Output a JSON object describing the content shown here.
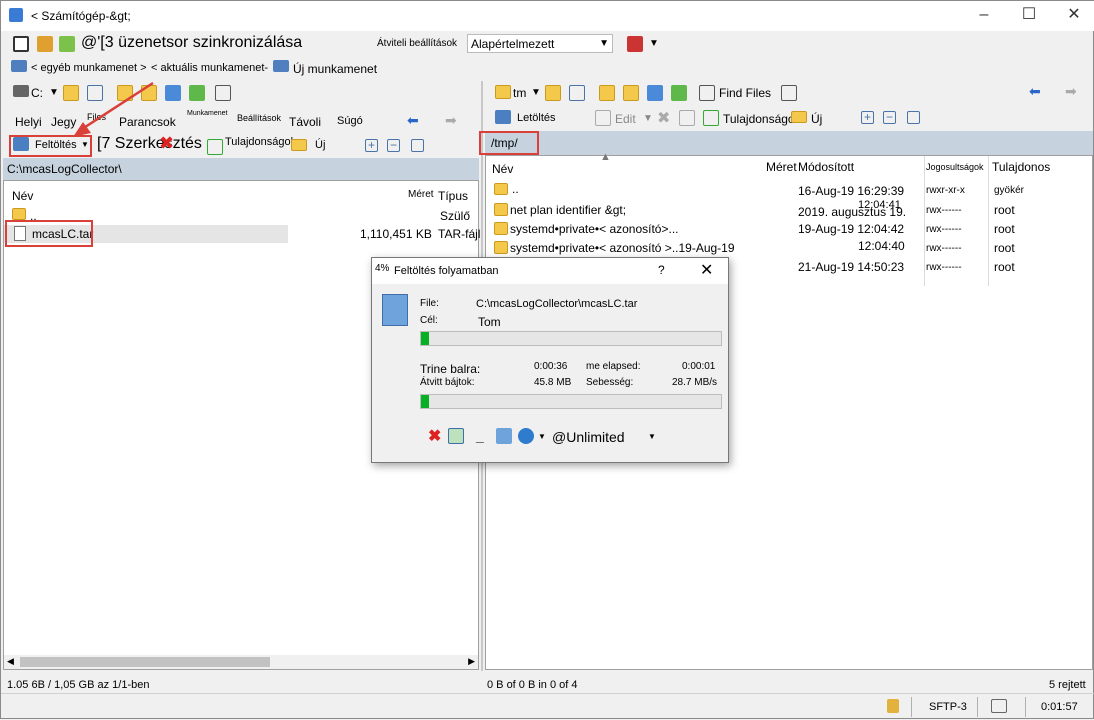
{
  "window": {
    "title": "< Számítógép-&gt;"
  },
  "toolbar1": {
    "sync_label": "@'[3 üzenetsor szinkronizálása",
    "transfer_settings_label": "Átviteli beállítások",
    "transfer_preset": "Alapértelmezett"
  },
  "sessions": {
    "other_session": "< egyéb munkamenet >",
    "current_session": "< aktuális munkamenet-",
    "new_session": "Új munkamenet"
  },
  "left": {
    "drive": "C:",
    "menu": {
      "local": "Helyi",
      "mark": "Jegy",
      "files": "Files",
      "commands": "Parancsok",
      "session": "Munkamenet",
      "settings": "Beállítások",
      "remote": "Távoli",
      "help": "Súgó"
    },
    "actions": {
      "upload": "Feltöltés",
      "edit": "[7 Szerkesztés",
      "properties": "Tulajdonságok",
      "new": "Új"
    },
    "path": "C:\\mcasLogCollector\\",
    "columns": {
      "name": "Név",
      "size": "Méret",
      "type": "Típus"
    },
    "rows": [
      {
        "name": "..",
        "size": "",
        "type": "Szülő"
      },
      {
        "name": "mcasLC.tar",
        "size": "1,110,451 KB",
        "type": "TAR-fájl"
      }
    ],
    "status": "1.05 6B / 1,05 GB az 1/1-ben"
  },
  "right": {
    "drive": "tm",
    "find_files": "Find Files",
    "actions": {
      "download": "Letöltés",
      "edit": "Edit",
      "properties": "Tulajdonságok",
      "new": "Új"
    },
    "path": "/tmp/",
    "columns": {
      "name": "Név",
      "size": "Méret",
      "modified": "Módosított",
      "rights": "Jogosultságok",
      "owner": "Tulajdonos"
    },
    "rows": [
      {
        "name": "..",
        "modified": "16-Aug-19 16:29:39",
        "rights": "rwxr-xr-x",
        "owner": "gyökér"
      },
      {
        "name": "net plan identifier &gt;",
        "modified": "2019. augusztus 19.",
        "modified_extra": "12:04:41",
        "rights": "rwx------",
        "owner": "root"
      },
      {
        "name": "systemd•private•< azonosító>...",
        "modified": "19-Aug-19 12:04:42",
        "rights": "rwx------",
        "owner": "root"
      },
      {
        "name": "systemd•private•< azonosító >..19-Aug-19",
        "modified": "12:04:40",
        "rights": "rwx------",
        "owner": "root"
      },
      {
        "name": "",
        "modified": "21-Aug-19 14:50:23",
        "rights": "rwx------",
        "owner": "root"
      }
    ],
    "status": "0 B of 0 B in 0 of 4",
    "hidden": "5 rejtett"
  },
  "statusbar": {
    "protocol": "SFTP-3",
    "elapsed": "0:01:57"
  },
  "dialog": {
    "title": "Feltöltés folyamatban",
    "percent": "4%",
    "help": "?",
    "file_label": "File:",
    "file_value": "C:\\mcasLogCollector\\mcasLC.tar",
    "target_label": "Cél:",
    "target_value": "Tom",
    "progress1": 0.025,
    "time_left_label": "Trine balra:",
    "time_left_value": "0:00:36",
    "elapsed_label": "me elapsed:",
    "elapsed_value": "0:00:01",
    "bytes_label": "Átvitt bájtok:",
    "bytes_value": "45.8 MB",
    "speed_label": "Sebesség:",
    "speed_value": "28.7 MB/s",
    "progress2": 0.025,
    "speed_limit": "@Unlimited"
  }
}
